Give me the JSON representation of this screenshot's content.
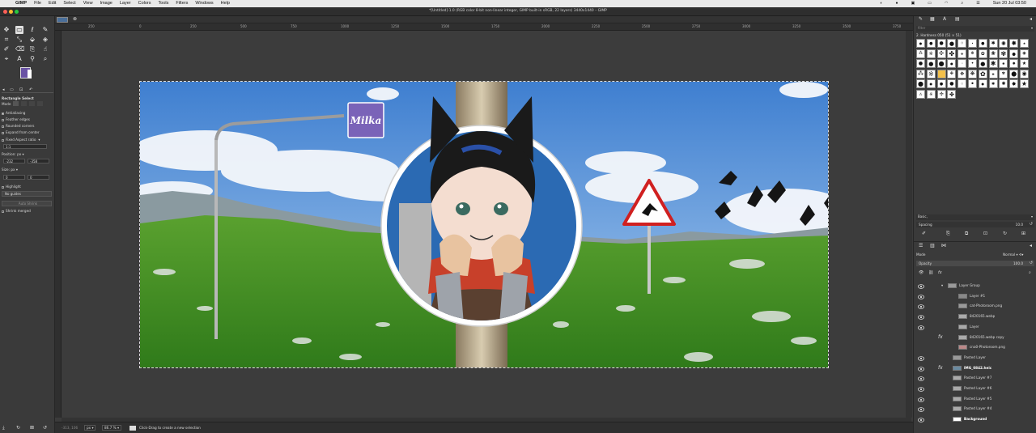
{
  "menubar": {
    "apple": "",
    "app": "GIMP",
    "items": [
      "File",
      "Edit",
      "Select",
      "View",
      "Image",
      "Layer",
      "Colors",
      "Tools",
      "Filters",
      "Windows",
      "Help"
    ],
    "clock": "Sun 20 Jul  03:50"
  },
  "window": {
    "title": "*[Untitled]-1.0 (RGB color 8-bit non-linear integer, GIMP built-in sRGB, 22 layers) 3440x1440 – GIMP"
  },
  "ruler": {
    "labels": [
      "250",
      "0",
      "250",
      "500",
      "750",
      "1000",
      "1250",
      "1500",
      "1750",
      "2000",
      "2250",
      "2500",
      "2750",
      "3000",
      "3250",
      "3500",
      "3750"
    ]
  },
  "tool_options": {
    "title": "Rectangle Select",
    "mode_label": "Mode",
    "antialiasing": "Antialiasing",
    "feather": "Feather edges",
    "rounded": "Rounded corners",
    "expand": "Expand from center",
    "fixed": "Fixed Aspect ratio",
    "ratio": "1:1",
    "position_label": "Position:",
    "position_unit": "px",
    "pos_x": "-232",
    "pos_y": "-358",
    "size_label": "Size:",
    "size_unit": "px",
    "size_w": "0",
    "size_h": "0",
    "highlight": "Highlight",
    "guides": "No guides",
    "auto_shrink": "Auto Shrink",
    "shrink_merged": "Shrink merged"
  },
  "canvas": {
    "sign_text": "Milka"
  },
  "statusbar": {
    "coords": "-313, 106",
    "unit": "px",
    "zoom": "86.7 %",
    "hint": "Click-Drag to create a new selection"
  },
  "brushes": {
    "filter_placeholder": "filter",
    "current": "2. Hardness 050 (51 × 51)",
    "preset": "Basic,",
    "spacing_label": "Spacing",
    "spacing_value": "10.0"
  },
  "layers": {
    "mode_label": "Mode",
    "mode_value": "Normal",
    "opacity_label": "Opacity",
    "opacity_value": "100.0",
    "items": [
      {
        "name": "Layer Group",
        "indent": 42,
        "group": true,
        "eye": true,
        "fx": false,
        "bold": false,
        "thumb": "#9a9a9a"
      },
      {
        "name": "Layer #1",
        "indent": 55,
        "eye": true,
        "fx": false,
        "bold": false,
        "thumb": "#888"
      },
      {
        "name": "cat-Photoroom.png",
        "indent": 55,
        "eye": true,
        "fx": false,
        "bold": false,
        "thumb": "#999"
      },
      {
        "name": "8420165.webp",
        "indent": 55,
        "eye": true,
        "fx": false,
        "bold": false,
        "thumb": "#aaa"
      },
      {
        "name": "Layer",
        "indent": 55,
        "eye": true,
        "fx": false,
        "bold": false,
        "thumb": "#aaa"
      },
      {
        "name": "8420165.webp copy",
        "indent": 55,
        "eye": false,
        "fx": true,
        "bold": false,
        "thumb": "#aaa"
      },
      {
        "name": "cna0-Photoroom.png",
        "indent": 55,
        "eye": false,
        "fx": false,
        "bold": false,
        "thumb": "#b88"
      },
      {
        "name": "Pasted Layer",
        "indent": 48,
        "eye": true,
        "fx": false,
        "bold": false,
        "thumb": "#999"
      },
      {
        "name": "IMG_0842.heic",
        "indent": 48,
        "eye": true,
        "fx": true,
        "bold": true,
        "thumb": "#6a8aa0"
      },
      {
        "name": "Pasted Layer #7",
        "indent": 48,
        "eye": true,
        "fx": false,
        "bold": false,
        "thumb": "#aaa"
      },
      {
        "name": "Pasted Layer #6",
        "indent": 48,
        "eye": true,
        "fx": false,
        "bold": false,
        "thumb": "#aaa"
      },
      {
        "name": "Pasted Layer #5",
        "indent": 48,
        "eye": true,
        "fx": false,
        "bold": false,
        "thumb": "#aaa"
      },
      {
        "name": "Pasted Layer #4",
        "indent": 48,
        "eye": true,
        "fx": false,
        "bold": false,
        "thumb": "#aaa"
      },
      {
        "name": "Background",
        "indent": 48,
        "eye": true,
        "fx": false,
        "bold": true,
        "thumb": "#fff"
      }
    ]
  },
  "colors": {
    "foreground": "#6a53a4",
    "background": "#ffffff",
    "milka": "#7a63b8"
  }
}
